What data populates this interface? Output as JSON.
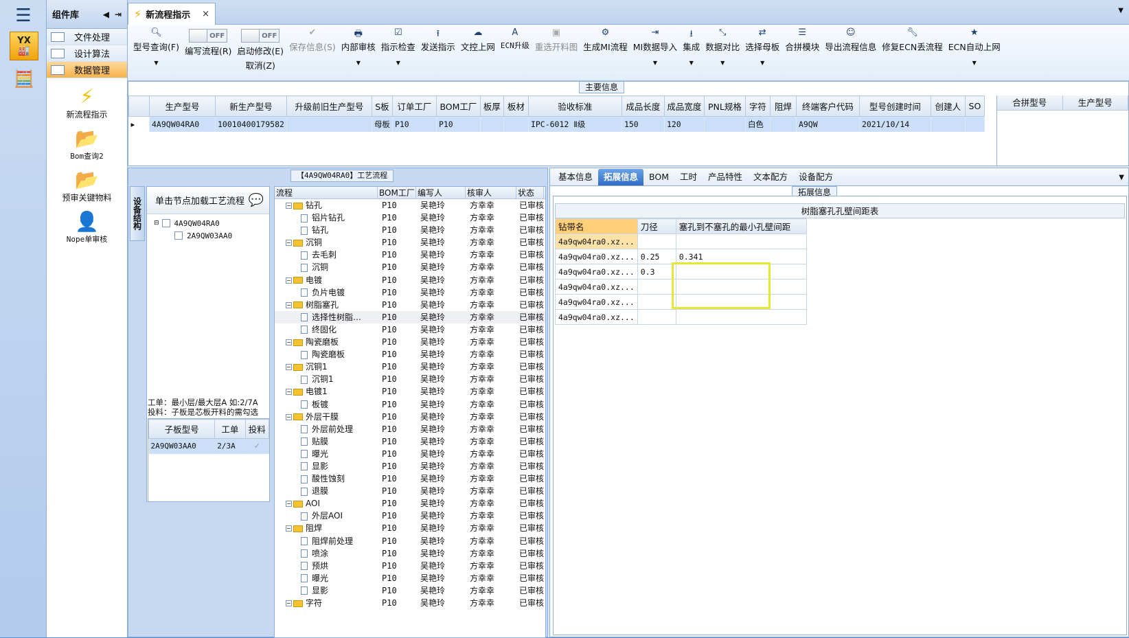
{
  "nav": {
    "yx_label": "YX"
  },
  "complib": {
    "title": "组件库",
    "items": [
      {
        "label": "文件处理"
      },
      {
        "label": "设计算法"
      },
      {
        "label": "数据管理"
      }
    ],
    "tools": [
      {
        "label": "新流程指示",
        "icon": "lightning-icon"
      },
      {
        "label": "Bom查询2",
        "icon": "folder-icon"
      },
      {
        "label": "预审关键物料",
        "icon": "folder-icon"
      },
      {
        "label": "Nope单审核",
        "icon": "user-icon"
      }
    ]
  },
  "tab": {
    "title": "新流程指示",
    "close": "×"
  },
  "toolbar": {
    "query": "型号查询(F)",
    "edit_flow": "编写流程(R)",
    "start_modify": "启动修改(E)",
    "cancel": "取消(Z)",
    "off": "OFF",
    "save": "保存信息(S)",
    "internal_review": "内部审核",
    "instruction_check": "指示检查",
    "send": "发送指示",
    "upload": "文控上网",
    "ecn_upgrade": "ECN升级",
    "reselect": "重选开料图",
    "gen_mi": "生成MI流程",
    "mi_import": "MI数据导入",
    "integrate": "集成",
    "compare": "数据对比",
    "select_template": "选择母板",
    "merge_module": "合拼模块",
    "export": "导出流程信息",
    "repair_ecn": "修复ECN丢流程",
    "ecn_auto": "ECN自动上网"
  },
  "maininfo": {
    "title": "主要信息",
    "columns": [
      "生产型号",
      "新生产型号",
      "升级前旧生产型号",
      "S板",
      "订单工厂",
      "BOM工厂",
      "板厚",
      "板材",
      "验收标准",
      "成品长度",
      "成品宽度",
      "PNL规格",
      "字符",
      "阻焊",
      "终端客户代码",
      "型号创建时间",
      "创建人",
      "SO"
    ],
    "row": [
      "4A9QW04RA0",
      "10010400179582",
      "",
      "母板",
      "P10",
      "P10",
      "",
      "",
      "IPC-6012 Ⅱ级",
      "150",
      "120",
      "",
      "白色",
      "",
      "A9QW",
      "2021/10/14",
      "",
      ""
    ],
    "merge_columns": [
      "合拼型号",
      "生产型号"
    ]
  },
  "lowerleft": {
    "vtab": "设备结构",
    "tree_header": "单击节点加载工艺流程",
    "tree": [
      "4A9QW04RA0",
      "2A9QW03AA0"
    ],
    "info_line1": "工单：最小层/最大层A 如:2/7A",
    "info_line2": "投料：子板是芯板开料的需勾选",
    "subgrid_cols": [
      "子板型号",
      "工单",
      "投料"
    ],
    "subgrid_row": [
      "2A9QW03AA0",
      "2/3A",
      "✓"
    ]
  },
  "process": {
    "title": "【4A9QW04RA0】工艺流程",
    "columns": [
      "流程",
      "BOM工厂",
      "编写人",
      "核审人",
      "状态"
    ],
    "rows": [
      {
        "name": "钻孔",
        "type": "folder"
      },
      {
        "name": "铝片钻孔",
        "type": "doc"
      },
      {
        "name": "钻孔",
        "type": "doc"
      },
      {
        "name": "沉铜",
        "type": "folder"
      },
      {
        "name": "去毛刺",
        "type": "doc"
      },
      {
        "name": "沉铜",
        "type": "doc"
      },
      {
        "name": "电镀",
        "type": "folder"
      },
      {
        "name": "负片电镀",
        "type": "doc"
      },
      {
        "name": "树脂塞孔",
        "type": "folder"
      },
      {
        "name": "选择性树脂…",
        "type": "doc"
      },
      {
        "name": "终固化",
        "type": "doc"
      },
      {
        "name": "陶瓷磨板",
        "type": "folder"
      },
      {
        "name": "陶瓷磨板",
        "type": "doc"
      },
      {
        "name": "沉铜1",
        "type": "folder"
      },
      {
        "name": "沉铜1",
        "type": "doc"
      },
      {
        "name": "电镀1",
        "type": "folder"
      },
      {
        "name": "板镀",
        "type": "doc"
      },
      {
        "name": "外层干膜",
        "type": "folder"
      },
      {
        "name": "外层前处理",
        "type": "doc"
      },
      {
        "name": "贴膜",
        "type": "doc"
      },
      {
        "name": "曝光",
        "type": "doc"
      },
      {
        "name": "显影",
        "type": "doc"
      },
      {
        "name": "酸性蚀刻",
        "type": "doc"
      },
      {
        "name": "退膜",
        "type": "doc"
      },
      {
        "name": "AOI",
        "type": "folder"
      },
      {
        "name": "外层AOI",
        "type": "doc"
      },
      {
        "name": "阻焊",
        "type": "folder"
      },
      {
        "name": "阻焊前处理",
        "type": "doc"
      },
      {
        "name": "喷涂",
        "type": "doc"
      },
      {
        "name": "预烘",
        "type": "doc"
      },
      {
        "name": "曝光",
        "type": "doc"
      },
      {
        "name": "显影",
        "type": "doc"
      },
      {
        "name": "字符",
        "type": "folder"
      }
    ],
    "bom": "P10",
    "author": "吴艳玲",
    "reviewer": "方幸幸",
    "status": "已审核"
  },
  "right": {
    "tabs": [
      "基本信息",
      "拓展信息",
      "BOM",
      "工时",
      "产品特性",
      "文本配方",
      "设备配方"
    ],
    "active_tab": 1,
    "section_title": "拓展信息",
    "table_caption": "树脂塞孔孔壁间距表",
    "cols": [
      "钻带名",
      "刀径",
      "塞孔到不塞孔的最小孔壁间距"
    ],
    "rows": [
      [
        "4a9qw04ra0.xz...",
        "",
        ""
      ],
      [
        "4a9qw04ra0.xz...",
        "0.25",
        "0.341"
      ],
      [
        "4a9qw04ra0.xz...",
        "0.3",
        ""
      ],
      [
        "4a9qw04ra0.xz...",
        "",
        ""
      ],
      [
        "4a9qw04ra0.xz...",
        "",
        ""
      ],
      [
        "4a9qw04ra0.xz...",
        "",
        ""
      ]
    ]
  }
}
